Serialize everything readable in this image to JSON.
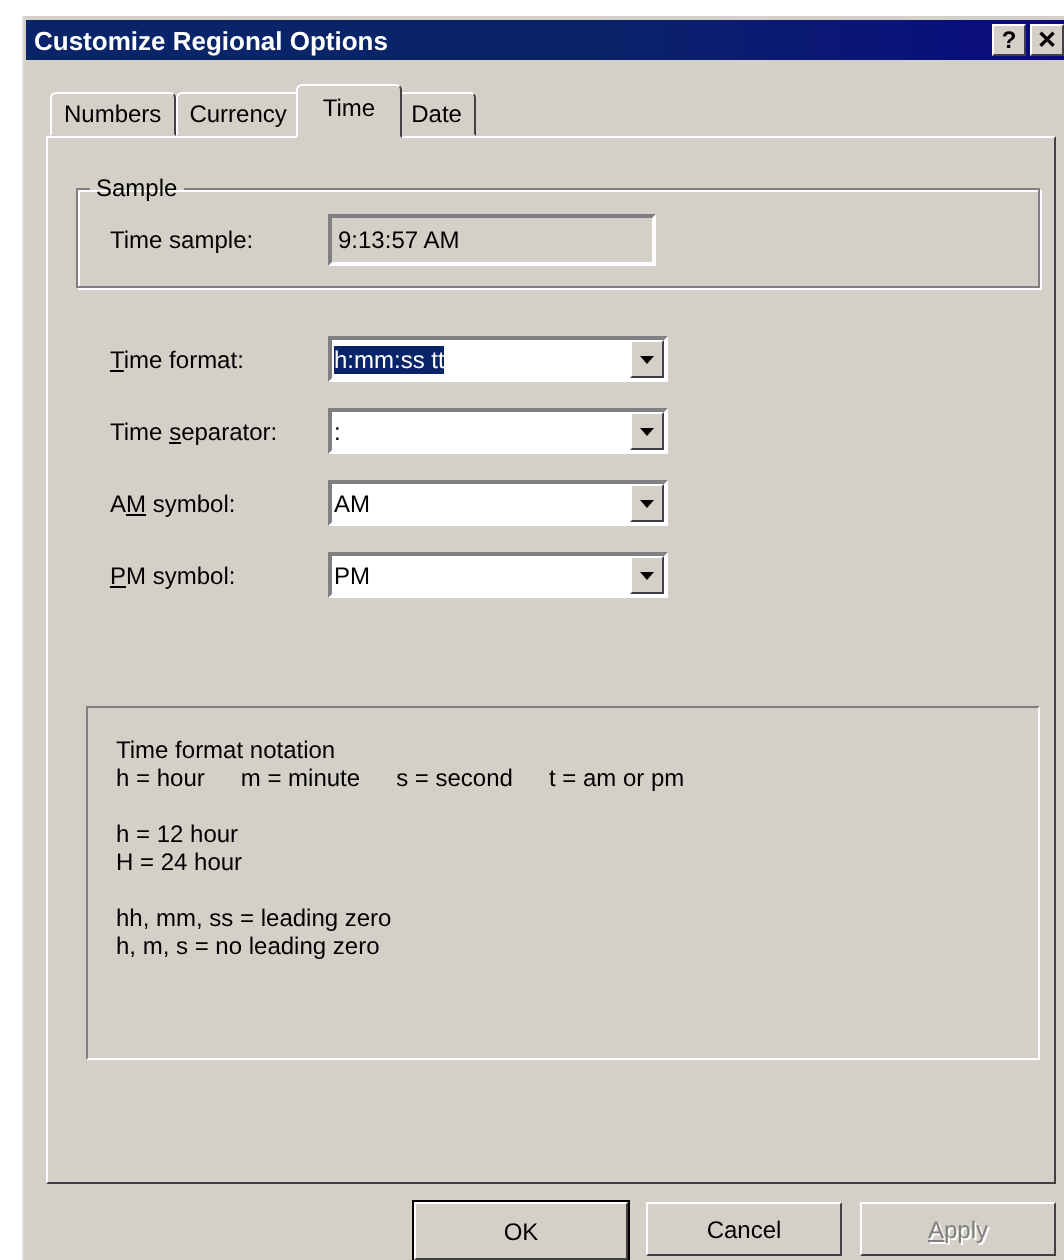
{
  "window": {
    "title": "Customize Regional Options",
    "title_buttons": [
      "?",
      "✕"
    ]
  },
  "tabs": [
    {
      "label": "Numbers",
      "selected": false
    },
    {
      "label": "Currency",
      "selected": false
    },
    {
      "label": "Time",
      "selected": true
    },
    {
      "label": "Date",
      "selected": false
    }
  ],
  "sample": {
    "legend": "Sample",
    "label": "Time sample:",
    "value": "9:13:57 AM"
  },
  "fields": [
    {
      "access_key": "T",
      "label_after": "ime format:",
      "value": "h:mm:ss tt",
      "text_selected": true
    },
    {
      "label_before": "Time ",
      "access_key": "s",
      "label_after": "eparator:",
      "value": ":",
      "text_selected": false
    },
    {
      "label_before": "A",
      "access_key": "M",
      "label_after": " symbol:",
      "value": "AM",
      "text_selected": false
    },
    {
      "access_key": "P",
      "label_after": "M symbol:",
      "value": "PM",
      "text_selected": false
    }
  ],
  "notation": {
    "title": "Time format notation",
    "legend_items": [
      "h = hour",
      "m = minute",
      "s = second",
      "t = am or pm"
    ],
    "groups": [
      [
        "h = 12 hour",
        "H = 24 hour"
      ],
      [
        "hh, mm, ss = leading zero",
        "h, m, s = no leading zero"
      ]
    ]
  },
  "buttons": [
    {
      "label_before": "OK",
      "disabled": false,
      "default": true
    },
    {
      "label_before": "Cancel",
      "disabled": false,
      "default": false
    },
    {
      "access_key": "A",
      "label_after": "pply",
      "disabled": true,
      "default": false
    }
  ]
}
